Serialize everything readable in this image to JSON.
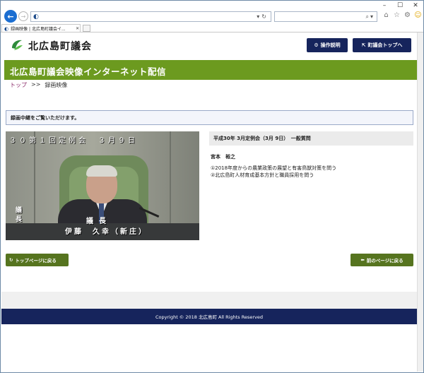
{
  "browser": {
    "controls": {
      "minimize": "–",
      "maximize": "☐",
      "close": "✕"
    },
    "tab": {
      "title": "録画映像 | 北広島町議会イ...",
      "close": "✕"
    }
  },
  "site": {
    "logo_text": "北広島町議会",
    "header_buttons": {
      "manual": "操作説明",
      "council_top": "町議会トップへ"
    },
    "banner_title": "北広島町議会映像インターネット配信",
    "breadcrumb": {
      "home": "トップ",
      "separator": ">>",
      "current": "録画映像"
    }
  },
  "main": {
    "notice": "録画中継をご覧いただけます。",
    "video": {
      "overlay_title": "３０第１回定例会　３月９日",
      "side_label": "議長",
      "role": "議長",
      "name": "伊藤　久幸（新庄）"
    },
    "meeting": "平成30年 3月定例会（3月 9日）　一般質問",
    "speaker": "宮本　裕之",
    "topics": [
      "①2018年度からの農業政策の展望と有害鳥獣対策を問う",
      "②北広島町人材育成基本方針と職員採用を問う"
    ],
    "buttons": {
      "back_top": "トップページに戻る",
      "prev_page": "前のページに戻る"
    }
  },
  "footer": {
    "copyright": "Copyright © 2018 北広島町 All Rights Reserved"
  },
  "colors": {
    "banner_green": "#6c9a1f",
    "button_navy": "#16245c",
    "button_green": "#56741f"
  }
}
